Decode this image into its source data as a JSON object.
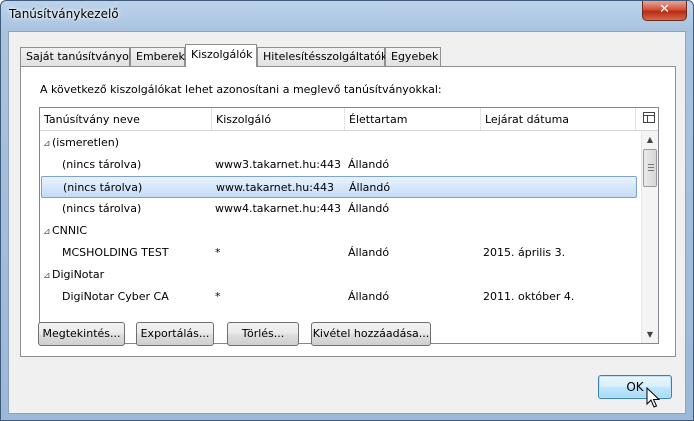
{
  "window": {
    "title": "Tanúsítványkezelő"
  },
  "tabs": [
    {
      "label": "Saját tanúsítványok"
    },
    {
      "label": "Emberek"
    },
    {
      "label": "Kiszolgálók"
    },
    {
      "label": "Hitelesítésszolgáltatók"
    },
    {
      "label": "Egyebek"
    }
  ],
  "panel": {
    "intro": "A következő kiszolgálókat lehet azonosítani a meglevő tanúsítványokkal:",
    "columns": [
      "Tanúsítvány neve",
      "Kiszolgáló",
      "Élettartam",
      "Lejárat dátuma"
    ],
    "rows": [
      {
        "name": "(ismeretlen)",
        "server": "",
        "lifetime": "",
        "expiry": ""
      },
      {
        "name": "(nincs tárolva)",
        "server": "www3.takarnet.hu:443",
        "lifetime": "Állandó",
        "expiry": ""
      },
      {
        "name": "(nincs tárolva)",
        "server": "www.takarnet.hu:443",
        "lifetime": "Állandó",
        "expiry": ""
      },
      {
        "name": "(nincs tárolva)",
        "server": "www4.takarnet.hu:443",
        "lifetime": "Állandó",
        "expiry": ""
      },
      {
        "name": "CNNIC",
        "server": "",
        "lifetime": "",
        "expiry": ""
      },
      {
        "name": "MCSHOLDING TEST",
        "server": "*",
        "lifetime": "Állandó",
        "expiry": "2015. április 3."
      },
      {
        "name": "DigiNotar",
        "server": "",
        "lifetime": "",
        "expiry": ""
      },
      {
        "name": "DigiNotar Cyber CA",
        "server": "*",
        "lifetime": "Állandó",
        "expiry": "2011. október 4."
      }
    ],
    "selected_row": 2
  },
  "buttons": {
    "view": "Megtekintés...",
    "export": "Exportálás...",
    "delete": "Törlés...",
    "add_exception": "Kivétel hozzáadása...",
    "ok": "OK"
  },
  "icons": {
    "close": "close-icon",
    "expander": "tree-expanded-icon",
    "column_picker": "column-picker-icon"
  }
}
